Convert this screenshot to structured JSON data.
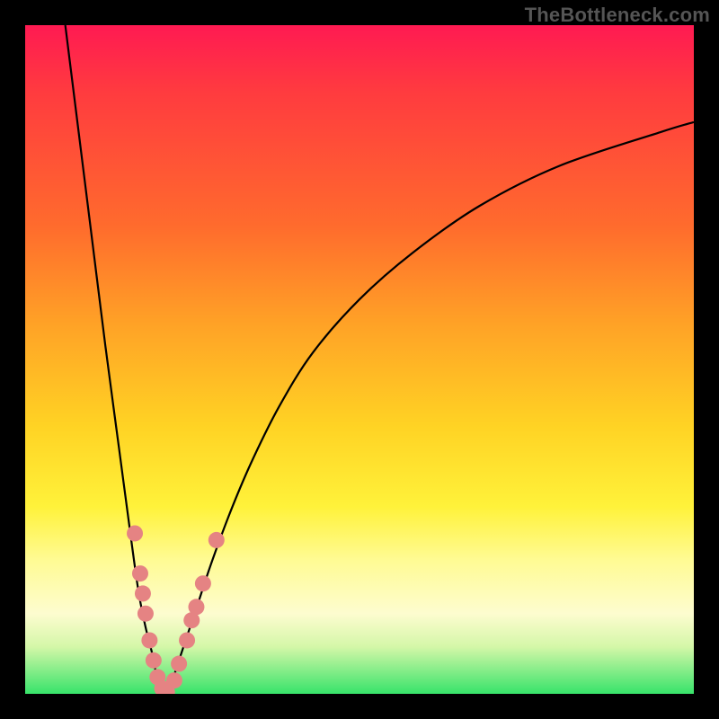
{
  "watermark": "TheBottleneck.com",
  "colors": {
    "dot": "#e58383",
    "curve": "#000000"
  },
  "chart_data": {
    "type": "line",
    "title": "",
    "xlabel": "",
    "ylabel": "",
    "xlim": [
      0,
      100
    ],
    "ylim": [
      0,
      100
    ],
    "series": [
      {
        "name": "left-branch",
        "x": [
          6,
          8,
          10,
          12,
          14,
          16,
          17,
          18,
          19,
          19.6,
          20.2,
          21
        ],
        "y": [
          100,
          84,
          68,
          52,
          37,
          22,
          15,
          10,
          6,
          3,
          1,
          0
        ]
      },
      {
        "name": "right-branch",
        "x": [
          21,
          22,
          23,
          24,
          26,
          28,
          31,
          34,
          38,
          43,
          50,
          58,
          68,
          80,
          95,
          100
        ],
        "y": [
          0,
          2,
          5,
          8,
          14,
          20,
          28,
          35,
          43,
          51,
          59,
          66,
          73,
          79,
          84,
          85.5
        ]
      }
    ],
    "dots": [
      {
        "x": 16.4,
        "y": 24
      },
      {
        "x": 17.2,
        "y": 18
      },
      {
        "x": 17.6,
        "y": 15
      },
      {
        "x": 18.0,
        "y": 12
      },
      {
        "x": 18.6,
        "y": 8
      },
      {
        "x": 19.2,
        "y": 5
      },
      {
        "x": 19.8,
        "y": 2.5
      },
      {
        "x": 20.5,
        "y": 0.8
      },
      {
        "x": 21.2,
        "y": 0.3
      },
      {
        "x": 22.3,
        "y": 2
      },
      {
        "x": 23.0,
        "y": 4.5
      },
      {
        "x": 24.2,
        "y": 8
      },
      {
        "x": 24.9,
        "y": 11
      },
      {
        "x": 25.6,
        "y": 13
      },
      {
        "x": 26.6,
        "y": 16.5
      },
      {
        "x": 28.6,
        "y": 23
      }
    ]
  }
}
